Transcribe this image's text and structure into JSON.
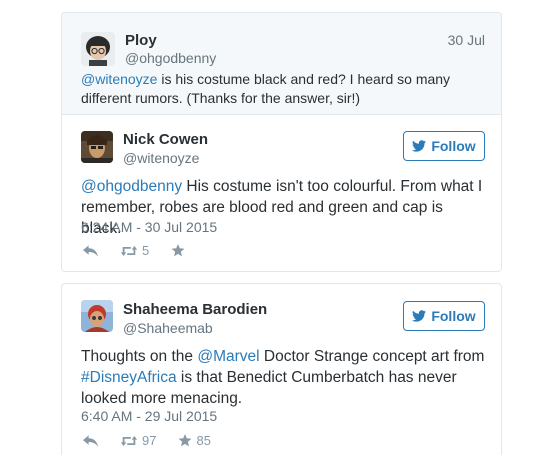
{
  "reply_tweet": {
    "author_name": "Ploy",
    "handle": "@ohgodbenny",
    "date": "30 Jul",
    "mention": "@witenoyze",
    "text_after_mention": " is his costume black and red? I heard so many different rumors. (Thanks for the answer, sir!)"
  },
  "tweet_1": {
    "author_name": "Nick Cowen",
    "handle": "@witenoyze",
    "follow_label": "Follow",
    "mention": "@ohgodbenny",
    "text_after_mention": " His costume isn't too colourful. From what I remember, robes are blood red and green and cap is black.",
    "timestamp": "6:24 AM - 30 Jul 2015",
    "retweet_count": "5",
    "favorite_count": ""
  },
  "tweet_2": {
    "author_name": "Shaheema Barodien",
    "handle": "@Shaheemab",
    "follow_label": "Follow",
    "text_part1": "Thoughts on the ",
    "mention": "@Marvel",
    "text_part2": " Doctor Strange concept art from ",
    "hashtag": "#DisneyAfrica",
    "text_part3": " is that Benedict Cumberbatch has never looked more menacing.",
    "timestamp": "6:40 AM - 29 Jul 2015",
    "retweet_count": "97",
    "favorite_count": "85"
  },
  "colors": {
    "link": "#2b7bb9",
    "muted": "#66757f",
    "icon": "#8899a6",
    "border": "#e1e8ed",
    "reply_bg": "#f5f8fa"
  },
  "icons": {
    "follow": "twitter-bird-icon",
    "reply": "reply-arrow-icon",
    "retweet": "retweet-icon",
    "favorite": "star-icon"
  }
}
